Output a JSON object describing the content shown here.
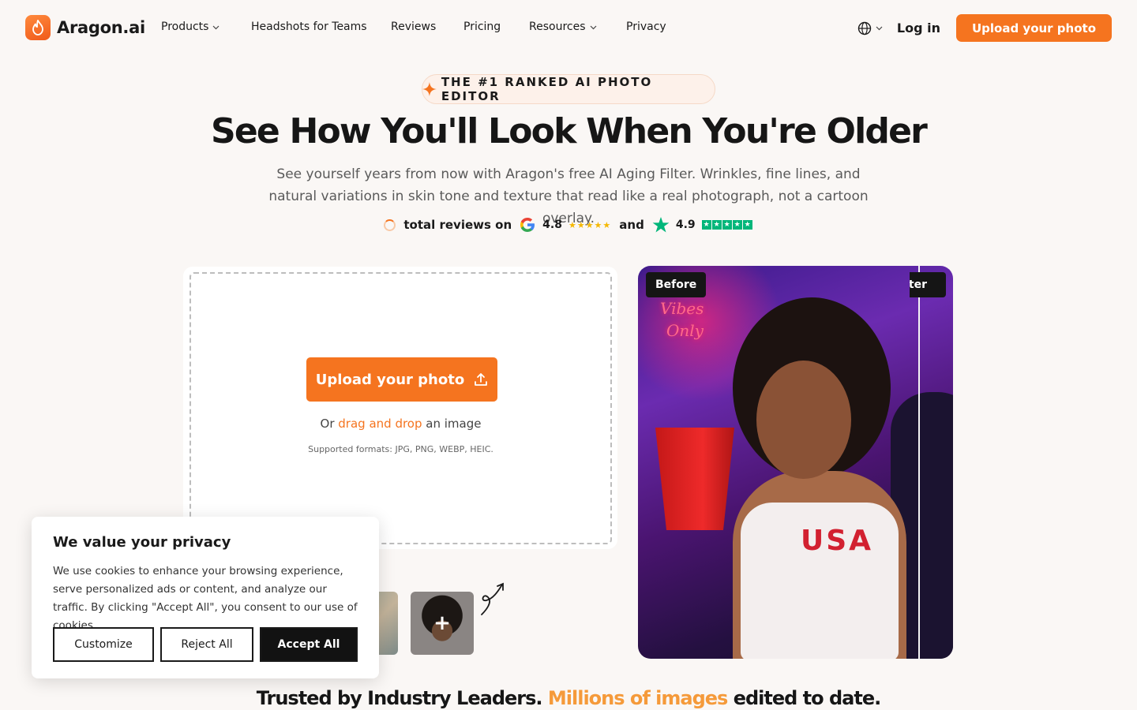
{
  "nav": {
    "brand": "Aragon.ai",
    "links": [
      {
        "label": "Products",
        "dropdown": true
      },
      {
        "label": "Headshots for Teams",
        "dropdown": false
      },
      {
        "label": "Reviews",
        "dropdown": false
      },
      {
        "label": "Pricing",
        "dropdown": false
      },
      {
        "label": "Resources",
        "dropdown": true
      },
      {
        "label": "Privacy",
        "dropdown": false
      }
    ],
    "login": "Log in",
    "cta": "Upload your photo"
  },
  "hero": {
    "badge": "THE #1 RANKED AI PHOTO EDITOR",
    "title": "See How You'll Look When You're Older",
    "subtitle": "See yourself years from now with Aragon's free AI Aging Filter. Wrinkles, fine lines, and natural variations in skin tone and texture that read like a real photograph, not a cartoon overlay.",
    "reviews": {
      "prefix": "total reviews on",
      "google_score": "4.8",
      "and": "and",
      "trustpilot_score": "4.9"
    }
  },
  "upload": {
    "button": "Upload your photo",
    "drag_prefix": "Or",
    "drag_link": "drag and drop",
    "drag_suffix": "an image",
    "formats": "Supported formats: JPG, PNG, WEBP, HEIC."
  },
  "preview": {
    "before_label": "Before",
    "after_label": "After",
    "neon_line1": "Vibes",
    "neon_line2": "Only",
    "shirt_text": "USA"
  },
  "cookie": {
    "title": "We value your privacy",
    "body": "We use cookies to enhance your browsing experience, serve personalized ads or content, and analyze our traffic. By clicking \"Accept All\", you consent to our use of cookies.",
    "customize": "Customize",
    "reject": "Reject All",
    "accept": "Accept All"
  },
  "trusted": {
    "part1": "Trusted by Industry Leaders.",
    "highlight": "Millions of images",
    "part2": "edited to date."
  },
  "colors": {
    "accent": "#f5741f",
    "background": "#faf7f5",
    "dark": "#121212"
  }
}
